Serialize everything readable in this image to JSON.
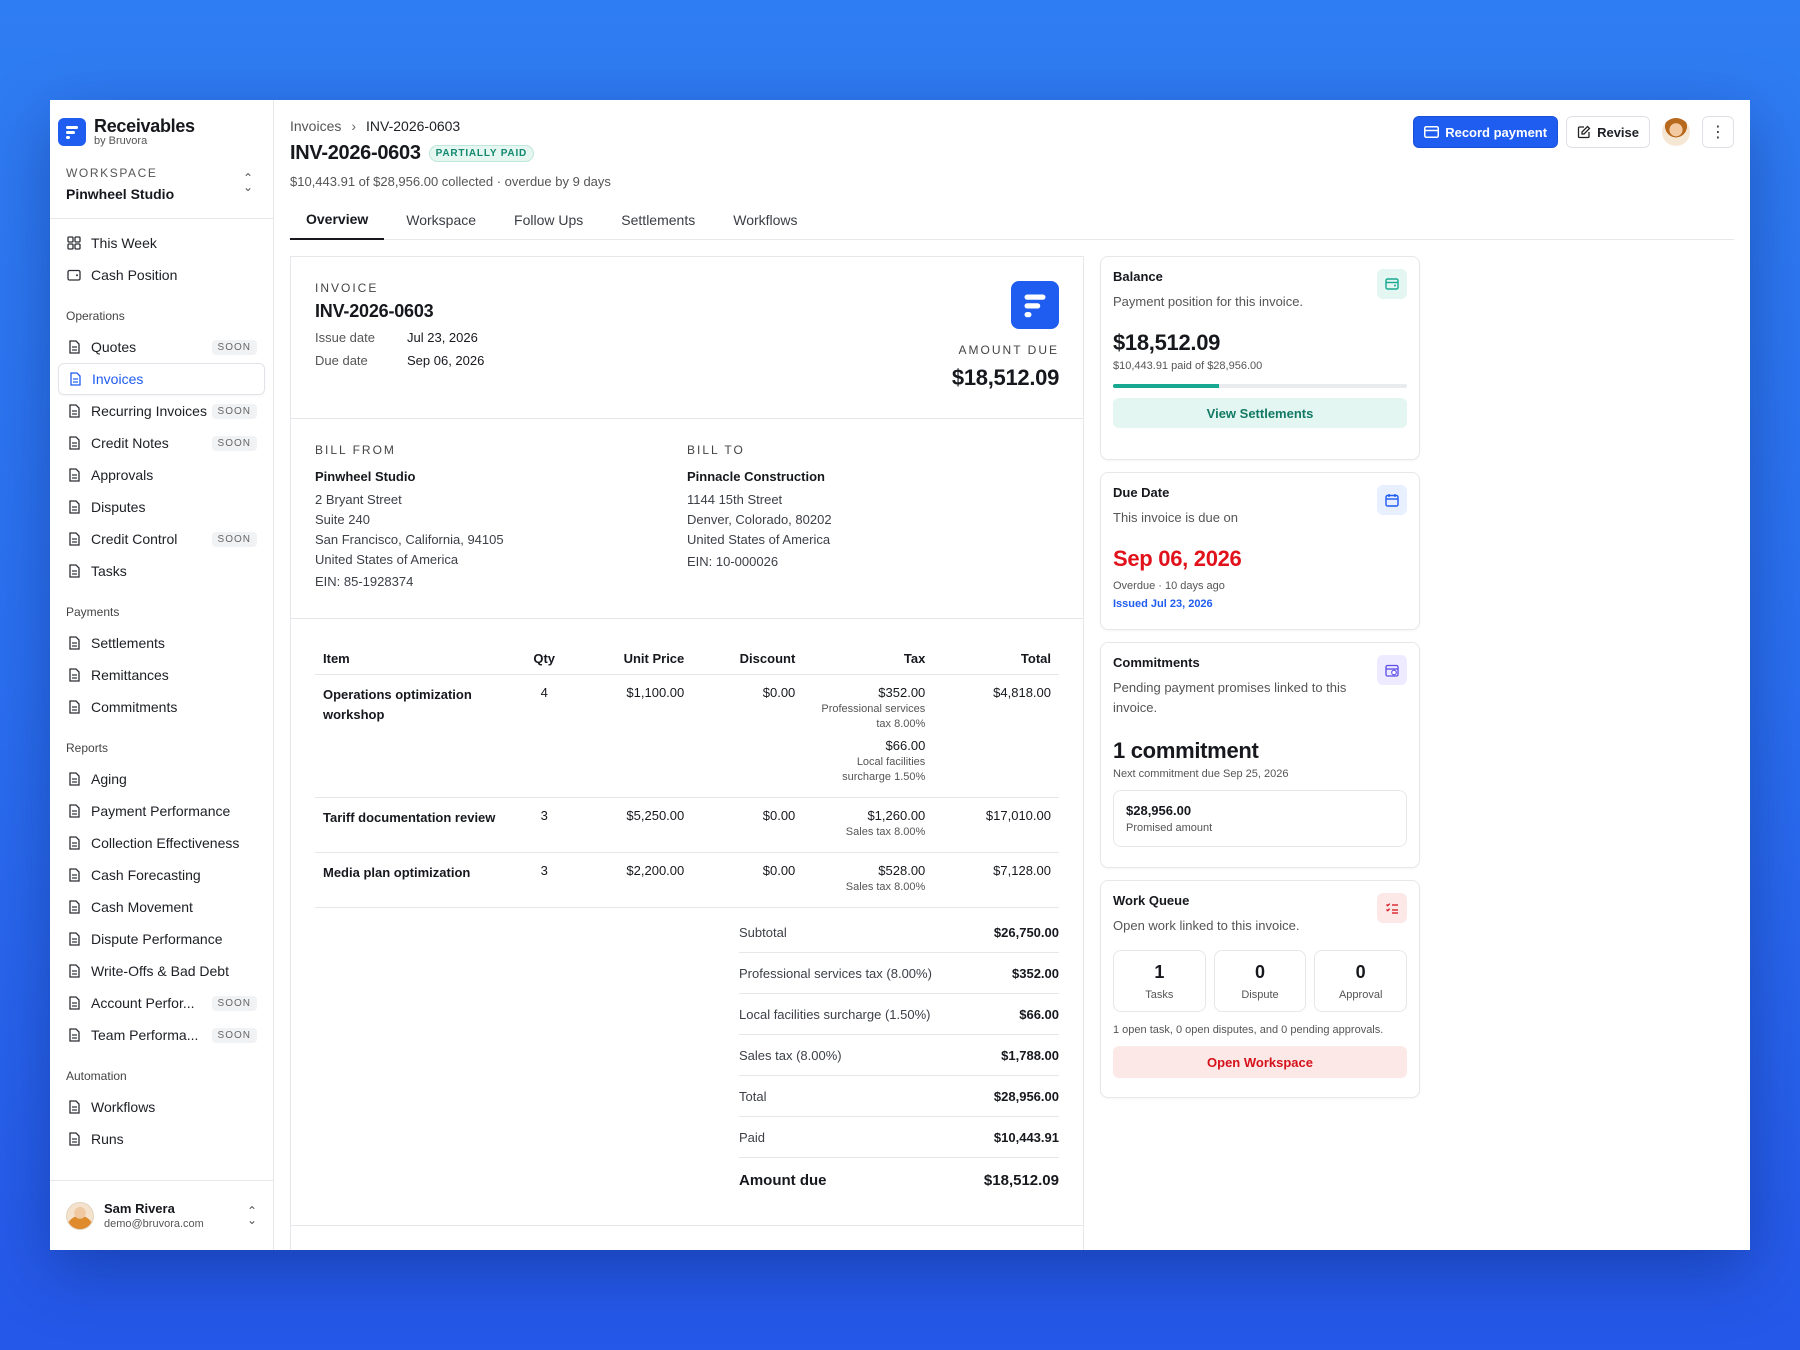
{
  "brand": {
    "name": "Receivables",
    "sub": "by Bruvora"
  },
  "workspace": {
    "label": "WORKSPACE",
    "name": "Pinwheel Studio"
  },
  "nav": {
    "top": [
      {
        "label": "This Week",
        "icon": "grid-icon"
      },
      {
        "label": "Cash Position",
        "icon": "wallet-icon"
      }
    ],
    "groups": [
      {
        "label": "Operations",
        "items": [
          {
            "label": "Quotes",
            "soon": "SOON"
          },
          {
            "label": "Invoices"
          },
          {
            "label": "Recurring Invoices",
            "soon": "SOON"
          },
          {
            "label": "Credit Notes",
            "soon": "SOON"
          },
          {
            "label": "Approvals"
          },
          {
            "label": "Disputes"
          },
          {
            "label": "Credit Control",
            "soon": "SOON"
          },
          {
            "label": "Tasks"
          }
        ]
      },
      {
        "label": "Payments",
        "items": [
          {
            "label": "Settlements"
          },
          {
            "label": "Remittances"
          },
          {
            "label": "Commitments"
          }
        ]
      },
      {
        "label": "Reports",
        "items": [
          {
            "label": "Aging"
          },
          {
            "label": "Payment Performance"
          },
          {
            "label": "Collection Effectiveness"
          },
          {
            "label": "Cash Forecasting"
          },
          {
            "label": "Cash Movement"
          },
          {
            "label": "Dispute Performance"
          },
          {
            "label": "Write-Offs & Bad Debt"
          },
          {
            "label": "Account Perfor...",
            "soon": "SOON"
          },
          {
            "label": "Team Performa...",
            "soon": "SOON"
          }
        ]
      },
      {
        "label": "Automation",
        "items": [
          {
            "label": "Workflows"
          },
          {
            "label": "Runs"
          }
        ]
      }
    ]
  },
  "user": {
    "name": "Sam Rivera",
    "email": "demo@bruvora.com"
  },
  "breadcrumb": {
    "parent": "Invoices",
    "current": "INV-2026-0603"
  },
  "header": {
    "title": "INV-2026-0603",
    "badge": "PARTIALLY PAID",
    "subtitle": "$10,443.91 of $28,956.00 collected · overdue by 9 days",
    "record_payment": "Record payment",
    "revise": "Revise"
  },
  "tabs": [
    "Overview",
    "Workspace",
    "Follow Ups",
    "Settlements",
    "Workflows"
  ],
  "invoice": {
    "eyebrow": "INVOICE",
    "number": "INV-2026-0603",
    "issue_label": "Issue date",
    "issue_date": "Jul 23, 2026",
    "due_label": "Due date",
    "due_date": "Sep 06, 2026",
    "amount_due_label": "AMOUNT DUE",
    "amount_due": "$18,512.09",
    "bill_from": {
      "label": "BILL FROM",
      "name": "Pinwheel Studio",
      "lines": [
        "2 Bryant Street",
        "Suite 240",
        "San Francisco, California, 94105",
        "United States of America"
      ],
      "ein": "EIN: 85-1928374"
    },
    "bill_to": {
      "label": "BILL TO",
      "name": "Pinnacle Construction",
      "lines": [
        "1144 15th Street",
        "Denver, Colorado, 80202",
        "United States of America"
      ],
      "ein": "EIN: 10-000026"
    },
    "columns": {
      "item": "Item",
      "qty": "Qty",
      "unit": "Unit Price",
      "discount": "Discount",
      "tax": "Tax",
      "total": "Total"
    },
    "rows": [
      {
        "item": "Operations optimization workshop",
        "qty": "4",
        "unit": "$1,100.00",
        "discount": "$0.00",
        "taxes": [
          {
            "amount": "$352.00",
            "note": "Professional services tax 8.00%"
          },
          {
            "amount": "$66.00",
            "note": "Local facilities surcharge 1.50%"
          }
        ],
        "total": "$4,818.00"
      },
      {
        "item": "Tariff documentation review",
        "qty": "3",
        "unit": "$5,250.00",
        "discount": "$0.00",
        "taxes": [
          {
            "amount": "$1,260.00",
            "note": "Sales tax 8.00%"
          }
        ],
        "total": "$17,010.00"
      },
      {
        "item": "Media plan optimization",
        "qty": "3",
        "unit": "$2,200.00",
        "discount": "$0.00",
        "taxes": [
          {
            "amount": "$528.00",
            "note": "Sales tax 8.00%"
          }
        ],
        "total": "$7,128.00"
      }
    ],
    "totals": [
      {
        "label": "Subtotal",
        "value": "$26,750.00"
      },
      {
        "label": "Professional services tax (8.00%)",
        "value": "$352.00"
      },
      {
        "label": "Local facilities surcharge (1.50%)",
        "value": "$66.00"
      },
      {
        "label": "Sales tax (8.00%)",
        "value": "$1,788.00"
      },
      {
        "label": "Total",
        "value": "$28,956.00"
      },
      {
        "label": "Paid",
        "value": "$10,443.91"
      }
    ],
    "final": {
      "label": "Amount due",
      "value": "$18,512.09"
    }
  },
  "balance": {
    "title": "Balance",
    "desc": "Payment position for this invoice.",
    "value": "$18,512.09",
    "note": "$10,443.91 paid of $28,956.00",
    "progress": 0.36,
    "button": "View Settlements"
  },
  "due": {
    "title": "Due Date",
    "desc": "This invoice is due on",
    "value": "Sep 06, 2026",
    "note": "Overdue · 10 days ago",
    "issued": "Issued Jul 23, 2026"
  },
  "commitments": {
    "title": "Commitments",
    "desc": "Pending payment promises linked to this invoice.",
    "value": "1 commitment",
    "note": "Next commitment due Sep 25, 2026",
    "promise_value": "$28,956.00",
    "promise_label": "Promised amount"
  },
  "work_queue": {
    "title": "Work Queue",
    "desc": "Open work linked to this invoice.",
    "cells": [
      {
        "n": "1",
        "t": "Tasks"
      },
      {
        "n": "0",
        "t": "Dispute"
      },
      {
        "n": "0",
        "t": "Approval"
      }
    ],
    "note": "1 open task, 0 open disputes, and 0 pending approvals.",
    "button": "Open Workspace"
  },
  "colors": {
    "accent": "#1f5cf0",
    "success": "#16a890",
    "danger": "#e1121b"
  }
}
